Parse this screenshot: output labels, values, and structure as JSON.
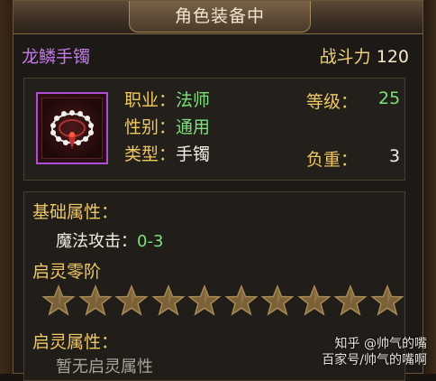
{
  "window": {
    "title": "角色装备中",
    "close_symbol": "✕"
  },
  "item": {
    "name": "龙鳞手镯",
    "power_label": "战斗力",
    "power_value": "120",
    "rarity_color": "#b04cd6",
    "icon": "bracelet-icon"
  },
  "attributes": {
    "profession_label": "职业：",
    "profession_value": "法师",
    "gender_label": "性别：",
    "gender_value": "通用",
    "type_label": "类型：",
    "type_value": "手镯",
    "level_label": "等级：",
    "level_value": "25",
    "weight_label": "负重：",
    "weight_value": "3"
  },
  "base": {
    "heading": "基础属性：",
    "magic_attack_label": "魔法攻击：",
    "magic_attack_value": "0-3"
  },
  "awaken_rank": {
    "heading": "启灵零阶",
    "stars_total": 10,
    "stars_filled": 0
  },
  "awaken_attr": {
    "heading": "启灵属性：",
    "empty_text": "暂无启灵属性"
  },
  "watermark": {
    "line1": "知乎 @帅气的嘴",
    "line2": "百家号/帅气的嘴啊"
  },
  "colors": {
    "gold_label": "#f0c862",
    "green_value": "#7ce07c",
    "purple_name": "#c27ae8"
  }
}
